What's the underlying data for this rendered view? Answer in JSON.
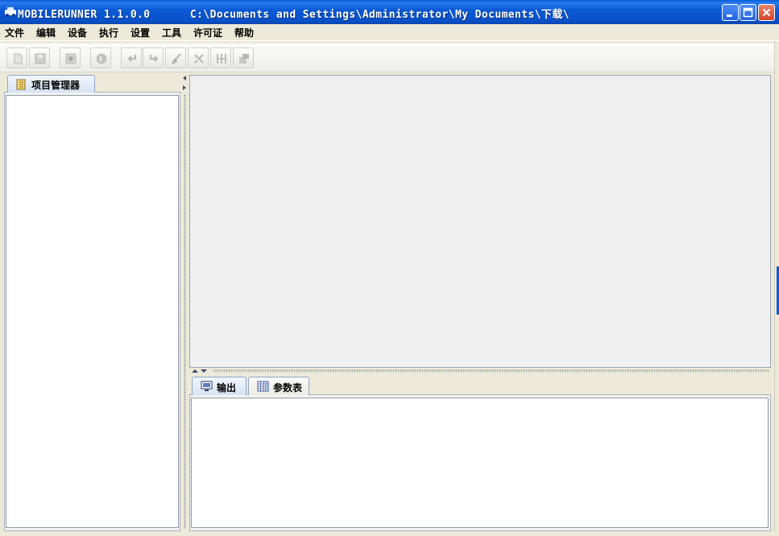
{
  "window": {
    "app_title": "MOBILERUNNER 1.1.0.0",
    "path": "C:\\Documents and Settings\\Administrator\\My Documents\\下载\\",
    "controls": {
      "minimize": "minimize-icon",
      "maximize": "maximize-icon",
      "close": "close-icon"
    },
    "accent_color": "#0a5ad6"
  },
  "menu": {
    "items": [
      {
        "label": "文件"
      },
      {
        "label": "编辑"
      },
      {
        "label": "设备"
      },
      {
        "label": "执行"
      },
      {
        "label": "设置"
      },
      {
        "label": "工具"
      },
      {
        "label": "许可证"
      },
      {
        "label": "帮助"
      }
    ]
  },
  "toolbar": {
    "buttons": [
      {
        "icon": "new-file-icon"
      },
      {
        "icon": "save-icon"
      },
      {
        "icon": "record-icon"
      },
      {
        "icon": "play-icon"
      },
      {
        "icon": "undo-icon"
      },
      {
        "icon": "redo-icon"
      },
      {
        "icon": "brush-icon"
      },
      {
        "icon": "tools-icon"
      },
      {
        "icon": "columns-icon"
      },
      {
        "icon": "window-icon"
      }
    ]
  },
  "left_panel": {
    "tab_label": "项目管理器",
    "tab_icon": "project-tree-icon"
  },
  "bottom_panel": {
    "tabs": [
      {
        "label": "输出",
        "icon": "monitor-icon",
        "selected": true
      },
      {
        "label": "参数表",
        "icon": "table-icon",
        "selected": false
      }
    ]
  }
}
